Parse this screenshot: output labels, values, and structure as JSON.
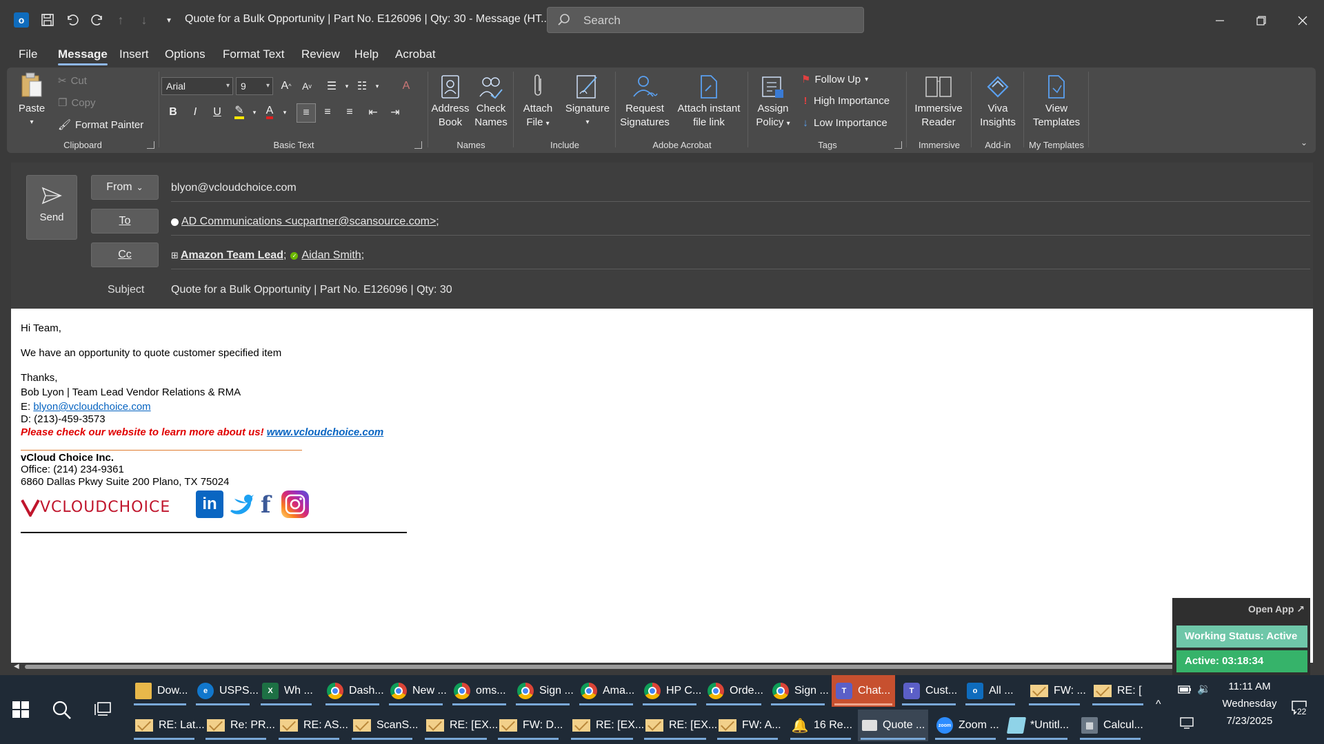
{
  "window": {
    "title": "Quote for a Bulk Opportunity | Part No. E126096 | Qty: 30  -  Message (HT...",
    "search_placeholder": "Search"
  },
  "menu_tabs": [
    "File",
    "Message",
    "Insert",
    "Options",
    "Format Text",
    "Review",
    "Help",
    "Acrobat"
  ],
  "ribbon": {
    "clipboard": {
      "label": "Clipboard",
      "paste": "Paste",
      "cut": "Cut",
      "copy": "Copy",
      "format_painter": "Format Painter"
    },
    "basic_text": {
      "label": "Basic Text",
      "font": "Arial",
      "size": "9"
    },
    "names": {
      "label": "Names",
      "address_book_1": "Address",
      "address_book_2": "Book",
      "check_names_1": "Check",
      "check_names_2": "Names"
    },
    "include": {
      "label": "Include",
      "attach_1": "Attach",
      "attach_2": "File",
      "signature": "Signature"
    },
    "adobe": {
      "label": "Adobe Acrobat",
      "request_1": "Request",
      "request_2": "Signatures",
      "instant_1": "Attach instant",
      "instant_2": "file link"
    },
    "tags": {
      "label": "Tags",
      "assign_1": "Assign",
      "assign_2": "Policy",
      "follow_up": "Follow Up",
      "high": "High Importance",
      "low": "Low Importance"
    },
    "immersive": {
      "label": "Immersive",
      "btn_1": "Immersive",
      "btn_2": "Reader"
    },
    "addin": {
      "label": "Add-in",
      "btn_1": "Viva",
      "btn_2": "Insights"
    },
    "templates": {
      "label": "My Templates",
      "btn_1": "View",
      "btn_2": "Templates"
    }
  },
  "compose": {
    "send": "Send",
    "from_label": "From",
    "from_value": "blyon@vcloudchoice.com",
    "to_label": "To",
    "to_value": "AD Communications <ucpartner@scansource.com>",
    "cc_label": "Cc",
    "cc_group": "Amazon Team Lead",
    "cc_person": "Aidan Smith",
    "subject_label": "Subject",
    "subject_value": "Quote for a Bulk Opportunity | Part No. E126096 | Qty: 30"
  },
  "body": {
    "greeting": "Hi Team,",
    "line1": "We have an opportunity to quote customer specified item",
    "thanks": "Thanks,",
    "sig_name": "Bob Lyon | Team Lead Vendor Relations & RMA",
    "email_prefix": "E: ",
    "email": "blyon@vcloudchoice.com",
    "direct": "D: (213)-459-3573",
    "promo": "Please check our website to learn more about us! ",
    "website": "www.vcloudchoice.com",
    "company": "vCloud Choice Inc.",
    "office": "Office: (214) 234-9361",
    "address": "6860 Dallas Pkwy Suite 200 Plano, TX 75024",
    "logo": "VCLOUDCHOICE"
  },
  "widget": {
    "open_app": "Open App ↗",
    "working_status": "Working Status: Active",
    "active": "Active: 03:18:34"
  },
  "taskbar": {
    "row1": [
      "Dow...",
      "USPS...",
      "Wh ...",
      "Dash...",
      "New ...",
      "oms...",
      "Sign ...",
      "Ama...",
      "HP C...",
      "Orde...",
      "Sign ...",
      "Chat...",
      "Cust...",
      "All ...",
      "FW: ...",
      "RE: ["
    ],
    "row2": [
      "RE: Lat...",
      "Re: PR...",
      "RE: AS...",
      "ScanS...",
      "RE: [EX...",
      "FW: D...",
      "RE: [EX...",
      "RE: [EX...",
      "FW: A...",
      "16 Re...",
      "Quote ...",
      "Zoom ...",
      "*Untitl...",
      "Calcul..."
    ],
    "time": "11:11 AM",
    "day": "Wednesday",
    "date": "7/23/2025",
    "notif_count": "22"
  },
  "colors": {
    "accent": "#8fb8ee",
    "link": "#0563c1",
    "promo_red": "#e00000",
    "chat_highlight": "#c7502f"
  }
}
